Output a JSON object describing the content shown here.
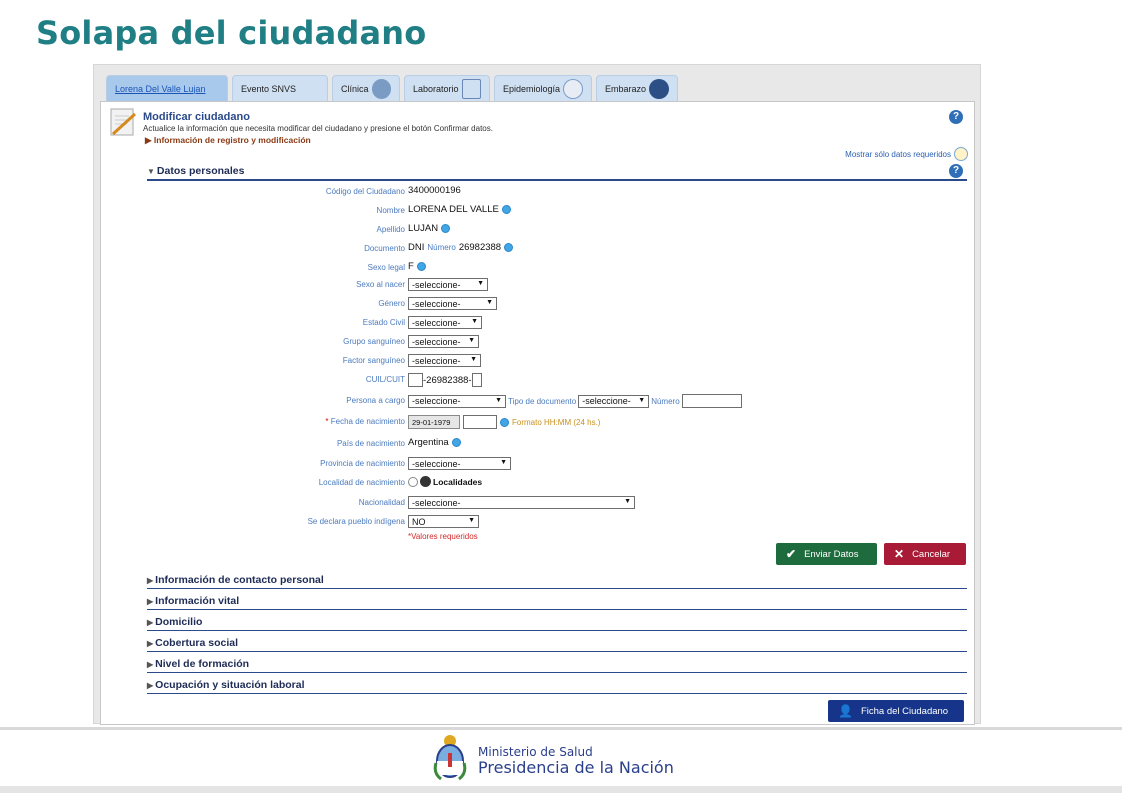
{
  "slide_title": "Solapa del ciudadano",
  "tabs": [
    {
      "label": "Lorena Del Valle Lujan",
      "icon": "person-tab"
    },
    {
      "label": "Evento SNVS",
      "icon": ""
    },
    {
      "label": "Clínica",
      "icon": "stethoscope-icon"
    },
    {
      "label": "Laboratorio",
      "icon": "test-tubes-icon"
    },
    {
      "label": "Epidemiología",
      "icon": "magnifier-dots-icon"
    },
    {
      "label": "Embarazo",
      "icon": "pregnancy-icon"
    }
  ],
  "header": {
    "title": "Modificar ciudadano",
    "description": "Actualice la información que necesita modificar del ciudadano y presione el botón Confirmar datos.",
    "info_link": "Información de registro y modificación",
    "required_link": "Mostrar sólo datos requeridos",
    "help": "?"
  },
  "datos_personales": {
    "title": "Datos personales",
    "codigo_label": "Código del Ciudadano",
    "codigo": "3400000196",
    "nombre_label": "Nombre",
    "nombre": "LORENA DEL VALLE",
    "apellido_label": "Apellido",
    "apellido": "LUJAN",
    "documento_label": "Documento",
    "doc_tipo": "DNI",
    "numero_label": "Número",
    "doc_numero": "26982388",
    "sexo_legal_label": "Sexo legal",
    "sexo_legal": "F",
    "sexo_nacer_label": "Sexo al nacer",
    "sexo_nacer": "-seleccione-",
    "genero_label": "Género",
    "genero": "-seleccione-",
    "estado_civil_label": "Estado Civil",
    "estado_civil": "-seleccione-",
    "grupo_label": "Grupo sanguíneo",
    "grupo": "-seleccione-",
    "factor_label": "Factor sanguíneo",
    "factor": "-seleccione-",
    "cuil_label": "CUIL/CUIT",
    "cuil": "-26982388-",
    "persona_cargo_label": "Persona a cargo",
    "persona_cargo": "-seleccione-",
    "tipo_doc_label": "Tipo de documento",
    "tipo_doc": "-seleccione-",
    "numero2_label": "Número",
    "fecha_label": "Fecha de nacimiento",
    "fecha_ast": "* ",
    "fecha": "29-01-1979",
    "formato": "Formato HH:MM (24 hs.)",
    "pais_label": "País de nacimiento",
    "pais": "Argentina",
    "provincia_label": "Provincia de nacimiento",
    "provincia": "-seleccione-",
    "localidad_label": "Localidad de nacimiento",
    "localidades": "Localidades",
    "nacionalidad_label": "Nacionalidad",
    "nacionalidad": "-seleccione-",
    "indigena_label": "Se declara pueblo indígena",
    "indigena": "NO",
    "valores_requeridos": "*Valores requeridos"
  },
  "buttons": {
    "enviar": "Enviar Datos",
    "cancelar": "Cancelar",
    "ficha": "Ficha del Ciudadano"
  },
  "sections": [
    "Información de contacto personal",
    "Información vital",
    "Domicilio",
    "Cobertura social",
    "Nivel de formación",
    "Ocupación y situación laboral"
  ],
  "footer": {
    "org_line1": "Ministerio de Salud",
    "org_line2": "Presidencia de la Nación"
  },
  "colors": {
    "title": "#1f7f84",
    "section_border": "#2b4a8a",
    "green_button": "#1e6b3d",
    "red_button": "#a81a35",
    "blue_button": "#16358a"
  }
}
